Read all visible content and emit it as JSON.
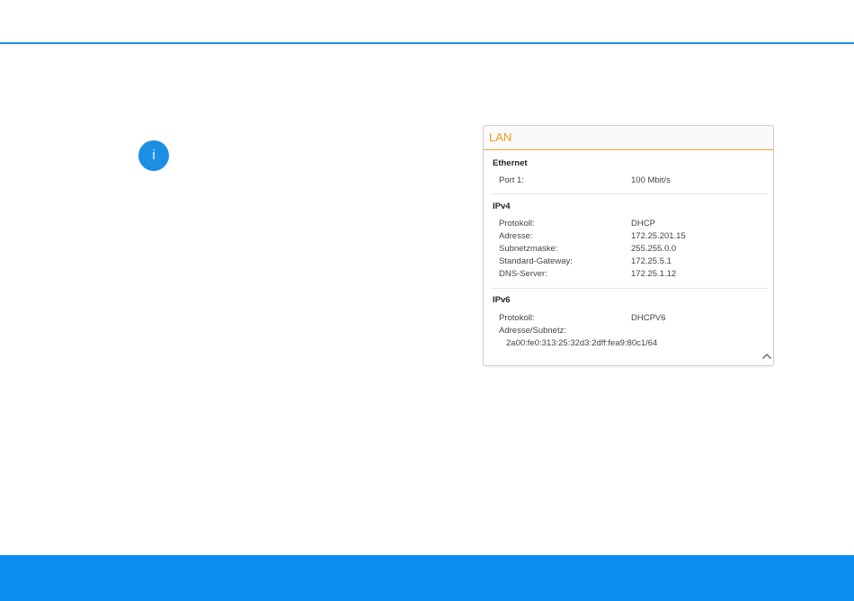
{
  "theme": {
    "accent": "#1a8fe3",
    "footer": "#0b8cf0",
    "panel_header_accent": "#f29a1f"
  },
  "info": {
    "icon_glyph": "i",
    "icon_name": "info-icon"
  },
  "lan_panel": {
    "title": "LAN",
    "ethernet": {
      "heading": "Ethernet",
      "port_label": "Port 1:",
      "port_value": "100 Mbit/s"
    },
    "ipv4": {
      "heading": "IPv4",
      "protocol_label": "Protokoll:",
      "protocol_value": "DHCP",
      "address_label": "Adresse:",
      "address_value": "172.25.201.15",
      "subnet_label": "Subnetzmaske:",
      "subnet_value": "255.255.0.0",
      "gateway_label": "Standard-Gateway:",
      "gateway_value": "172.25.5.1",
      "dns_label": "DNS-Server:",
      "dns_value": "172.25.1.12"
    },
    "ipv6": {
      "heading": "IPv6",
      "protocol_label": "Protokoll:",
      "protocol_value": "DHCPV6",
      "address_label": "Adresse/Subnetz:",
      "address_value": "2a00:fe0:313:25:32d3:2dff:fea9:80c1/64"
    },
    "collapse_icon_name": "chevron-up-icon",
    "collapse_glyph": "^"
  }
}
